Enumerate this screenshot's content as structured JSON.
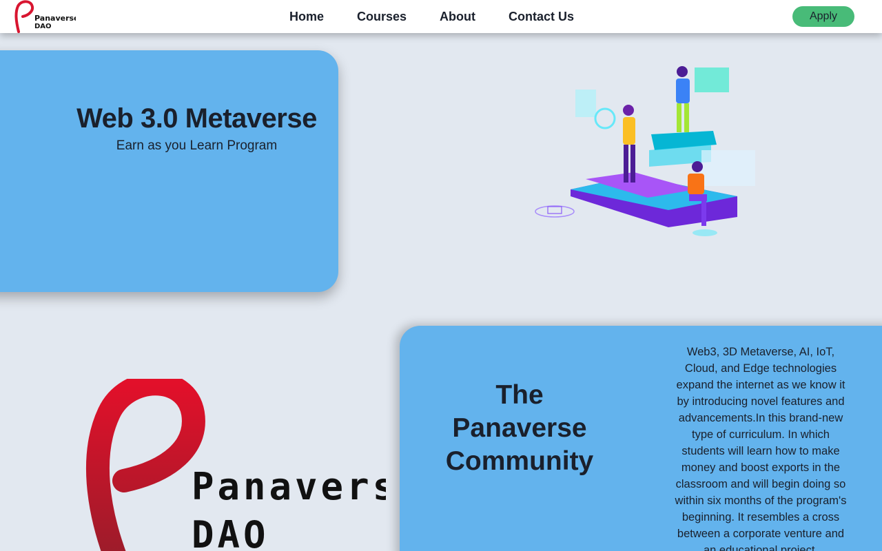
{
  "nav": {
    "logo_text_1": "Panaverse",
    "logo_text_2": "DAO",
    "links": [
      "Home",
      "Courses",
      "About",
      "Contact Us"
    ],
    "apply_label": "Apply"
  },
  "hero": {
    "title": "Web 3.0 Metaverse",
    "subtitle": "Earn as you Learn Program"
  },
  "brand": {
    "logo_text_1": "Panaverse",
    "logo_text_2": "DAO"
  },
  "community": {
    "title": "The Panaverse Community",
    "description": "Web3, 3D Metaverse, AI, IoT, Cloud, and Edge technologies expand the internet as we know it by introducing novel features and advancements.In this brand-new type of curriculum. In which students will learn how to make money and boost exports in the classroom and will begin doing so within six months of the program's beginning. It resembles a cross between a corporate venture and an educational project."
  },
  "colors": {
    "card_blue": "#63b3ed",
    "apply_green": "#48bb78",
    "logo_red": "#d81530",
    "page_bg": "#e2e8f0"
  },
  "icons": [
    "panaverse-logo-icon",
    "metaverse-vr-illustration"
  ]
}
